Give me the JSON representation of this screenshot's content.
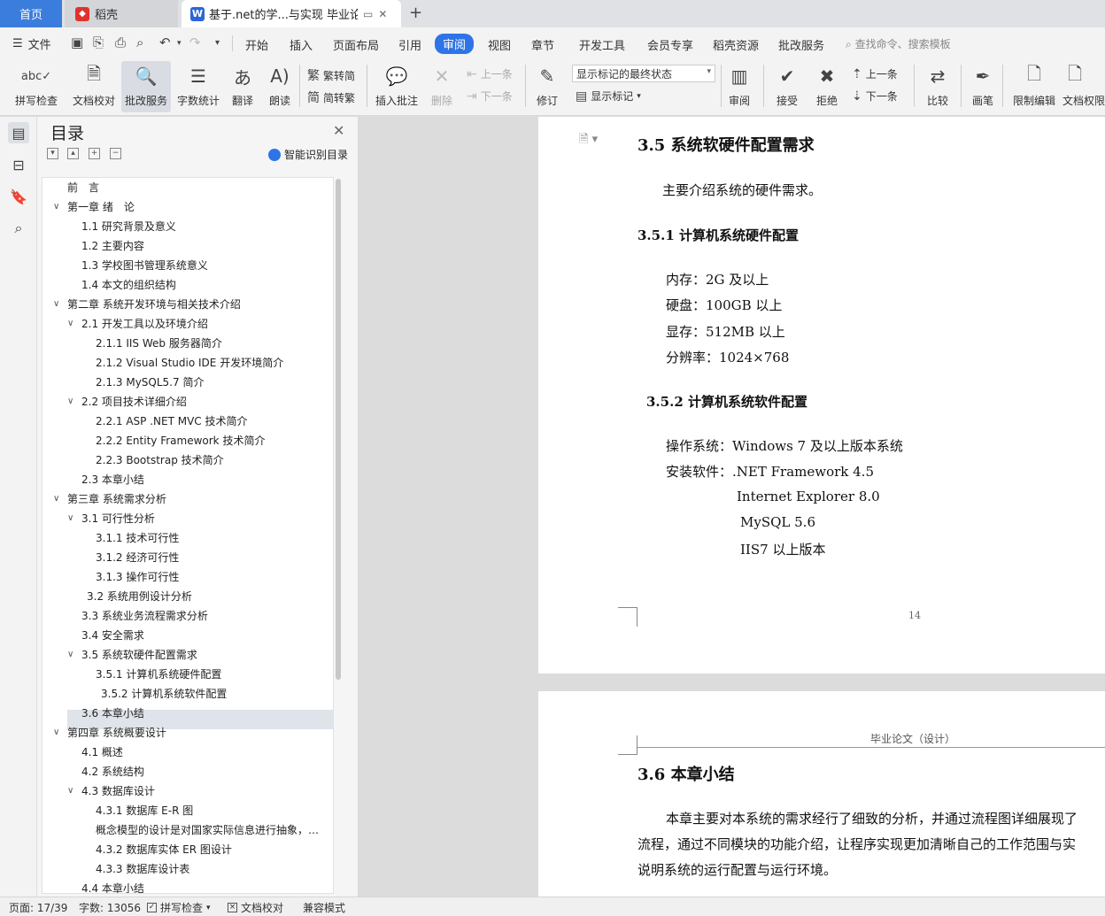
{
  "tabs": {
    "home": "首页",
    "daoke": "稻壳",
    "doc": "基于.net的学...与实现 毕业论文",
    "add": "+"
  },
  "menu": {
    "file": "文件",
    "items": [
      "开始",
      "插入",
      "页面布局",
      "引用",
      "审阅",
      "视图",
      "章节",
      "开发工具",
      "会员专享",
      "稻壳资源",
      "批改服务"
    ],
    "active": "审阅",
    "search": "查找命令、搜索模板"
  },
  "ribbon": {
    "spellcheck": "拼写检查",
    "proofread": "文档校对",
    "correction": "批改服务",
    "wordcount": "字数统计",
    "translate": "翻译",
    "read": "朗读",
    "to_traditional": "繁转简",
    "to_simplified": "简转繁",
    "insert_comment": "插入批注",
    "delete": "删除",
    "prev_comment": "上一条",
    "next_comment": "下一条",
    "revise": "修订",
    "markup_state": "显示标记的最终状态",
    "show_markup": "显示标记",
    "review": "审阅",
    "accept": "接受",
    "reject": "拒绝",
    "prev_change": "上一条",
    "next_change": "下一条",
    "compare": "比较",
    "ink": "画笔",
    "restrict_edit": "限制编辑",
    "doc_permission": "文档权限"
  },
  "toc": {
    "title": "目录",
    "ai": "智能识别目录",
    "items": [
      {
        "text": "前　言",
        "level": 1,
        "chev": ""
      },
      {
        "text": "第一章 绪　论",
        "level": 1,
        "chev": "v"
      },
      {
        "text": "1.1 研究背景及意义",
        "level": 2,
        "chev": ""
      },
      {
        "text": "1.2 主要内容",
        "level": 2,
        "chev": ""
      },
      {
        "text": "1.3 学校图书管理系统意义",
        "level": 2,
        "chev": ""
      },
      {
        "text": "1.4 本文的组织结构",
        "level": 2,
        "chev": ""
      },
      {
        "text": "第二章  系统开发环境与相关技术介绍",
        "level": 1,
        "chev": "v"
      },
      {
        "text": "2.1 开发工具以及环境介绍",
        "level": 2,
        "chev": "v"
      },
      {
        "text": "2.1.1 IIS Web 服务器简介",
        "level": 3,
        "chev": ""
      },
      {
        "text": "2.1.2 Visual Studio IDE 开发环境简介",
        "level": 3,
        "chev": ""
      },
      {
        "text": "2.1.3 MySQL5.7  简介",
        "level": 3,
        "chev": ""
      },
      {
        "text": "2.2 项目技术详细介绍",
        "level": 2,
        "chev": "v"
      },
      {
        "text": "2.2.1 ASP .NET MVC 技术简介",
        "level": 3,
        "chev": ""
      },
      {
        "text": "2.2.2 Entity Framework 技术简介",
        "level": 3,
        "chev": ""
      },
      {
        "text": "2.2.3 Bootstrap 技术简介",
        "level": 3,
        "chev": ""
      },
      {
        "text": "2.3 本章小结",
        "level": 2,
        "chev": ""
      },
      {
        "text": "第三章  系统需求分析",
        "level": 1,
        "chev": "v"
      },
      {
        "text": "3.1 可行性分析",
        "level": 2,
        "chev": "v"
      },
      {
        "text": "3.1.1 技术可行性",
        "level": 3,
        "chev": ""
      },
      {
        "text": "3.1.2  经济可行性",
        "level": 3,
        "chev": ""
      },
      {
        "text": "3.1.3 操作可行性",
        "level": 3,
        "chev": ""
      },
      {
        "text": "3.2 系统用例设计分析",
        "level": 2.4,
        "chev": ""
      },
      {
        "text": "3.3 系统业务流程需求分析",
        "level": 2,
        "chev": ""
      },
      {
        "text": "3.4 安全需求",
        "level": 2,
        "chev": ""
      },
      {
        "text": "3.5 系统软硬件配置需求",
        "level": 2,
        "chev": "v"
      },
      {
        "text": "3.5.1 计算机系统硬件配置",
        "level": 3,
        "chev": ""
      },
      {
        "text": "3.5.2 计算机系统软件配置",
        "level": 3.3,
        "chev": ""
      },
      {
        "text": "3.6 本章小结",
        "level": 2,
        "chev": ""
      },
      {
        "text": "第四章  系统概要设计",
        "level": 1,
        "chev": "v"
      },
      {
        "text": "4.1 概述",
        "level": 2,
        "chev": ""
      },
      {
        "text": "4.2 系统结构",
        "level": 2,
        "chev": ""
      },
      {
        "text": "4.3 数据库设计",
        "level": 2,
        "chev": "v"
      },
      {
        "text": "4.3.1 数据库 E-R 图",
        "level": 3,
        "chev": ""
      },
      {
        "text": "概念模型的设计是对国家实际信息进行抽象，实…",
        "level": 3,
        "chev": ""
      },
      {
        "text": "4.3.2 数据库实体 ER 图设计",
        "level": 3,
        "chev": ""
      },
      {
        "text": "4.3.3 数据库设计表",
        "level": 3,
        "chev": ""
      },
      {
        "text": "4.4 本章小结",
        "level": 2,
        "chev": ""
      }
    ],
    "selected": "3.5 系统软硬件配置需求"
  },
  "doc": {
    "p1_heading": "3.5 系统软硬件配置需求",
    "p1_intro": "主要介绍系统的硬件需求。",
    "hw_heading": "3.5.1 计算机系统硬件配置",
    "hw_lines": [
      "内存：2G 及以上",
      "硬盘：100GB 以上",
      "显存：512MB 以上",
      "分辨率：1024×768"
    ],
    "sw_heading": "3.5.2 计算机系统软件配置",
    "sw_os": "操作系统：Windows 7 及以上版本系统",
    "sw_install": "安装软件：.NET Framework 4.5",
    "sw_ie": "Internet Explorer 8.0",
    "sw_mysql": "MySQL 5.6",
    "sw_iis": "IIS7 以上版本",
    "page_number": "14",
    "p2_header": "毕业论文（设计）",
    "p2_heading": "3.6 本章小结",
    "p2_lines": [
      "本章主要对本系统的需求经行了细致的分析，并通过流程图详细展现了",
      "流程，通过不同模块的功能介绍，让程序实现更加清晰自己的工作范围与实",
      "说明系统的运行配置与运行环境。"
    ]
  },
  "status": {
    "page": "页面: 17/39",
    "words": "字数: 13056",
    "spell": "拼写检查",
    "proof": "文档校对",
    "compat": "兼容模式"
  }
}
